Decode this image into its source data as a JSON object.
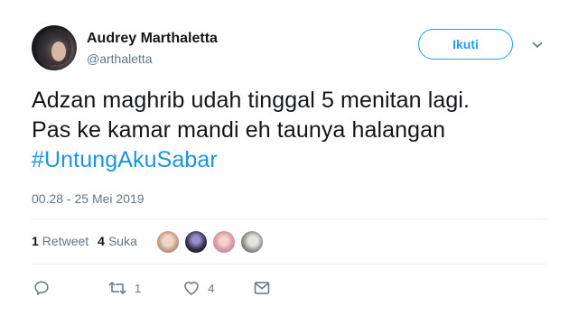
{
  "user": {
    "display_name": "Audrey Marthaletta",
    "handle": "@arthaletta"
  },
  "follow_button": {
    "label": "Ikuti"
  },
  "tweet": {
    "line1": "Adzan maghrib udah tinggal 5 menitan lagi.",
    "line2": "Pas ke kamar mandi eh taunya halangan",
    "hashtag": "#UntungAkuSabar",
    "timestamp": "00.28 - 25 Mei 2019"
  },
  "stats": {
    "retweet_count": "1",
    "retweet_label": "Retweet",
    "like_count": "4",
    "like_label": "Suka"
  },
  "likers": [
    {
      "color": "#c9a58e"
    },
    {
      "color": "#2b2840"
    },
    {
      "color": "#d99aa3"
    },
    {
      "color": "#9a9a9a"
    }
  ],
  "actions": {
    "reply_icon": "reply-icon",
    "retweet_icon": "retweet-icon",
    "retweet_count": "1",
    "like_icon": "heart-icon",
    "like_count": "4",
    "message_icon": "envelope-icon"
  },
  "colors": {
    "accent": "#1da1f2",
    "hashtag": "#1b95e0",
    "secondary_text": "#657786",
    "divider": "#e6ecf0"
  }
}
